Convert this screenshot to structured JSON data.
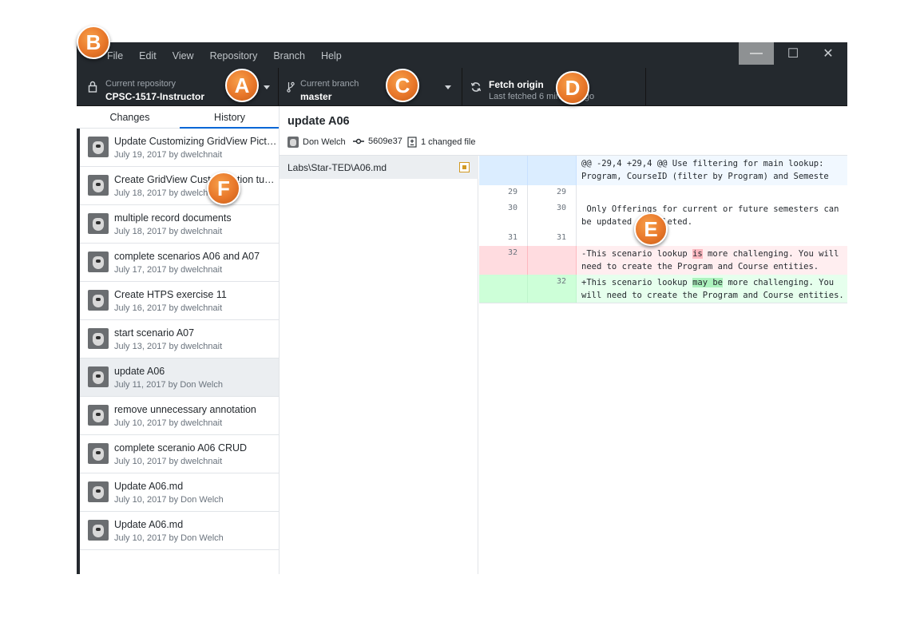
{
  "menu": [
    "File",
    "Edit",
    "View",
    "Repository",
    "Branch",
    "Help"
  ],
  "window_controls": {
    "minimize": "—",
    "maximize": "☐",
    "close": "✕"
  },
  "toolbar": {
    "repo": {
      "caption": "Current repository",
      "value": "CPSC-1517-Instructor"
    },
    "branch": {
      "caption": "Current branch",
      "value": "master"
    },
    "fetch": {
      "caption": "Fetch origin",
      "value": "Last fetched 6 minutes ago"
    }
  },
  "tabs": {
    "changes": "Changes",
    "history": "History"
  },
  "commits": [
    {
      "title": "",
      "meta": "July 19, 2017 by dwelchnait"
    },
    {
      "title": "Update Customizing GridView Picture...",
      "meta": "July 19, 2017 by dwelchnait"
    },
    {
      "title": "Create GridView Customization tuto...",
      "meta": "July 18, 2017 by dwelchnait"
    },
    {
      "title": "multiple record documents",
      "meta": "July 18, 2017 by dwelchnait"
    },
    {
      "title": "complete scenarios A06 and A07",
      "meta": "July 17, 2017 by dwelchnait"
    },
    {
      "title": "Create HTPS exercise 11",
      "meta": "July 16, 2017 by dwelchnait"
    },
    {
      "title": "start scenario A07",
      "meta": "July 13, 2017 by dwelchnait"
    },
    {
      "title": "update A06",
      "meta": "July 11, 2017 by Don Welch"
    },
    {
      "title": "remove unnecessary annotation",
      "meta": "July 10, 2017 by dwelchnait"
    },
    {
      "title": "complete sceranio A06 CRUD",
      "meta": "July 10, 2017 by dwelchnait"
    },
    {
      "title": "Update A06.md",
      "meta": "July 10, 2017 by Don Welch"
    },
    {
      "title": "Update A06.md",
      "meta": "July 10, 2017 by Don Welch"
    }
  ],
  "detail": {
    "title": "update A06",
    "author": "Don Welch",
    "sha": "5609e37",
    "changed": "1 changed file",
    "file": "Labs\\Star-TED\\A06.md"
  },
  "diff": {
    "hunk": "@@ -29,4 +29,4 @@ Use filtering for main lookup: Program, CourseID (filter by Program) and Semeste",
    "lines": [
      {
        "old": "29",
        "new": "29",
        "text": ""
      },
      {
        "old": "30",
        "new": "30",
        "text": " Only Offerings for current or future semesters can be updated or deleted."
      },
      {
        "old": "31",
        "new": "31",
        "text": ""
      }
    ],
    "del": {
      "old": "32",
      "pre": "-This scenario lookup ",
      "hl": "is",
      "post": " more challenging. You will need to create the Program and Course entities."
    },
    "add": {
      "new": "32",
      "pre": "+This scenario lookup ",
      "hl": "may be",
      "post": " more challenging. You will need to create the Program and Course entities."
    }
  },
  "badges": {
    "a": "A",
    "b": "B",
    "c": "C",
    "d": "D",
    "e": "E",
    "f": "F"
  },
  "colors": {
    "app_dark": "#24292e",
    "accent": "#0366d6",
    "badge": "#e8772a"
  }
}
